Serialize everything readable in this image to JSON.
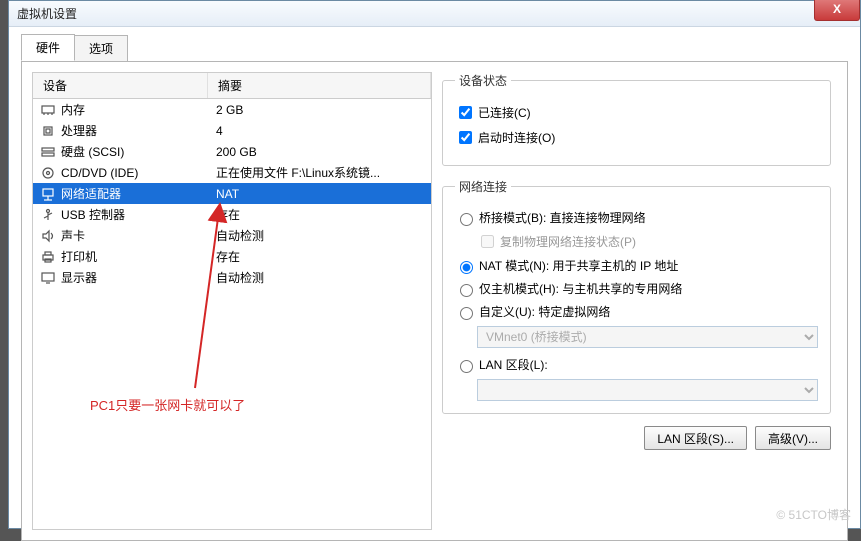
{
  "window": {
    "title": "虚拟机设置",
    "close_glyph": "X"
  },
  "tabs": {
    "hardware": "硬件",
    "options": "选项"
  },
  "columns": {
    "device": "设备",
    "summary": "摘要"
  },
  "devices": [
    {
      "icon": "memory-icon",
      "name": "内存",
      "summary": "2 GB"
    },
    {
      "icon": "cpu-icon",
      "name": "处理器",
      "summary": "4"
    },
    {
      "icon": "disk-icon",
      "name": "硬盘 (SCSI)",
      "summary": "200 GB"
    },
    {
      "icon": "cd-icon",
      "name": "CD/DVD (IDE)",
      "summary": "正在使用文件 F:\\Linux系统镜..."
    },
    {
      "icon": "net-icon",
      "name": "网络适配器",
      "summary": "NAT"
    },
    {
      "icon": "usb-icon",
      "name": "USB 控制器",
      "summary": "存在"
    },
    {
      "icon": "sound-icon",
      "name": "声卡",
      "summary": "自动检测"
    },
    {
      "icon": "printer-icon",
      "name": "打印机",
      "summary": "存在"
    },
    {
      "icon": "display-icon",
      "name": "显示器",
      "summary": "自动检测"
    }
  ],
  "selected_index": 4,
  "annotation": "PC1只要一张网卡就可以了",
  "device_state": {
    "legend": "设备状态",
    "connected": "已连接(C)",
    "connect_at_poweron": "启动时连接(O)",
    "connected_checked": true,
    "poweron_checked": true
  },
  "network": {
    "legend": "网络连接",
    "bridged": "桥接模式(B): 直接连接物理网络",
    "replicate": "复制物理网络连接状态(P)",
    "nat": "NAT 模式(N): 用于共享主机的 IP 地址",
    "hostonly": "仅主机模式(H): 与主机共享的专用网络",
    "custom": "自定义(U): 特定虚拟网络",
    "custom_value": "VMnet0 (桥接模式)",
    "lan": "LAN 区段(L):",
    "lan_value": "",
    "selected": "nat"
  },
  "buttons": {
    "lan_seg": "LAN 区段(S)...",
    "advanced": "高级(V)..."
  },
  "watermark": "© 51CTO博客"
}
